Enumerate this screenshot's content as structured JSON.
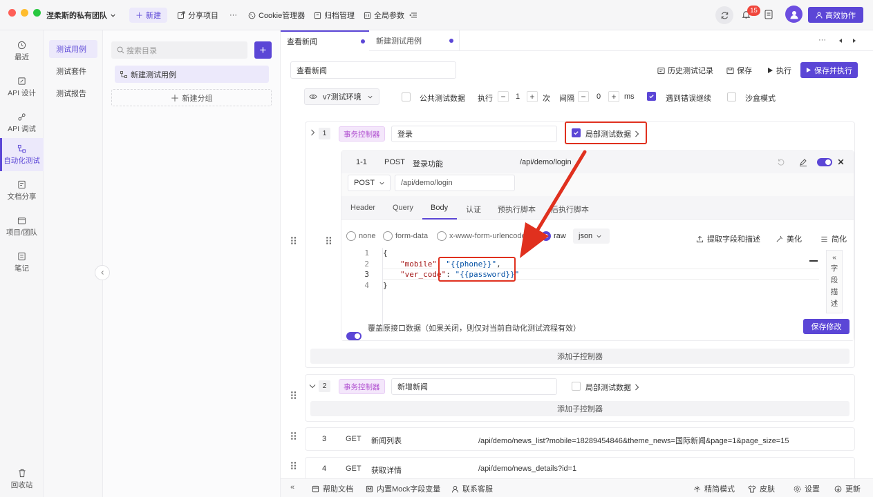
{
  "titlebar": {
    "team": "涅柔斯的私有团队",
    "new": "新建",
    "share": "分享项目",
    "more": "···",
    "cookie": "Cookie管理器",
    "archive": "归档管理",
    "params": "全局参数",
    "badge": "15",
    "collab": "高效协作"
  },
  "nav": {
    "items": [
      "最近",
      "API 设计",
      "API 调试",
      "自动化测试",
      "文档分享",
      "项目/团队",
      "笔记"
    ],
    "recycle": "回收站"
  },
  "subnav": [
    "测试用例",
    "测试套件",
    "测试报告"
  ],
  "tree": {
    "search_placeholder": "搜索目录",
    "case": "新建测试用例",
    "new_group": "新建分组"
  },
  "tabs": [
    "查看新闻",
    "新建测试用例"
  ],
  "toolbar": {
    "name": "查看新闻",
    "history": "历史测试记录",
    "save": "保存",
    "run": "执行",
    "save_run": "保存并执行"
  },
  "env": {
    "name": "v7测试环境",
    "public_data": "公共测试数据",
    "exec": "执行",
    "exec_count": "1",
    "times": "次",
    "interval": "间隔",
    "interval_val": "0",
    "ms": "ms",
    "continue_on_error": "遇到错误继续",
    "sandbox": "沙盒模式"
  },
  "steps": {
    "s1": {
      "num": "1",
      "tag": "事务控制器",
      "name": "登录",
      "local_data": "局部测试数据"
    },
    "sub": {
      "num": "1-1",
      "method": "POST",
      "name": "登录功能",
      "path": "/api/demo/login"
    },
    "request": {
      "method": "POST",
      "path": "/api/demo/login"
    },
    "req_tabs": [
      "Header",
      "Query",
      "Body",
      "认证",
      "预执行脚本",
      "后执行脚本"
    ],
    "body_types": [
      "none",
      "form-data",
      "x-www-form-urlencoded",
      "raw"
    ],
    "format": "json",
    "extract": "提取字段和描述",
    "beautify": "美化",
    "simplify": "简化",
    "code_lines": [
      "1",
      "2",
      "3",
      "4"
    ],
    "code": {
      "open": "{",
      "k1": "\"mobile\"",
      "v1": "\"{{phone}}\"",
      "k2": "\"ver_code\"",
      "v2": "\"{{password}}\"",
      "close": "}"
    },
    "field_desc": [
      "字",
      "段",
      "描",
      "述"
    ],
    "override": "覆盖原接口数据（如果关闭，则仅对当前自动化测试流程有效）",
    "save_changes": "保存修改",
    "add_child": "添加子控制器",
    "s2": {
      "num": "2",
      "tag": "事务控制器",
      "name": "新增新闻",
      "local_data": "局部测试数据"
    },
    "s3": {
      "num": "3",
      "method": "GET",
      "name": "新闻列表",
      "path": "/api/demo/news_list?mobile=18289454846&theme_news=国际新闻&page=1&page_size=15"
    },
    "s4": {
      "num": "4",
      "method": "GET",
      "name": "获取详情",
      "path": "/api/demo/news_details?id=1"
    }
  },
  "footer": {
    "help": "帮助文档",
    "mock": "内置Mock字段变量",
    "support": "联系客服",
    "simple": "精简模式",
    "skin": "皮肤",
    "settings": "设置",
    "update": "更新"
  },
  "colors": {
    "accent": "#5b46d6",
    "annotation": "#e0301e"
  }
}
